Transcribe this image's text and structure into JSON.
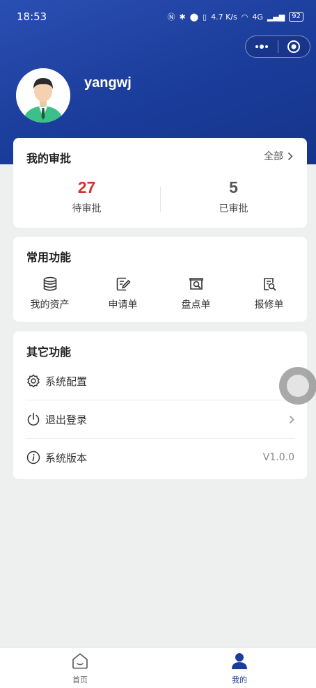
{
  "status_bar": {
    "time": "18:53",
    "net_speed": "4.7 K/s",
    "signal": "4G",
    "battery": "92"
  },
  "profile": {
    "username": "yangwj"
  },
  "approval": {
    "title": "我的审批",
    "all_label": "全部",
    "pending": {
      "value": "27",
      "label": "待审批",
      "color": "#d0342c"
    },
    "approved": {
      "value": "5",
      "label": "已审批",
      "color": "#555555"
    }
  },
  "common": {
    "title": "常用功能",
    "items": [
      {
        "label": "我的资产",
        "icon": "database-icon"
      },
      {
        "label": "申请单",
        "icon": "edit-form-icon"
      },
      {
        "label": "盘点单",
        "icon": "inventory-search-icon"
      },
      {
        "label": "报修单",
        "icon": "repair-search-icon"
      }
    ]
  },
  "other": {
    "title": "其它功能",
    "items": [
      {
        "label": "系统配置",
        "icon": "gear-icon"
      },
      {
        "label": "退出登录",
        "icon": "power-icon"
      },
      {
        "label": "系统版本",
        "icon": "info-icon",
        "value": "V1.0.0"
      }
    ]
  },
  "tabbar": {
    "items": [
      {
        "label": "首页",
        "icon": "home-icon",
        "active": false
      },
      {
        "label": "我的",
        "icon": "user-icon",
        "active": true
      }
    ],
    "active_color": "#1a3c9a",
    "inactive_color": "#666666"
  }
}
